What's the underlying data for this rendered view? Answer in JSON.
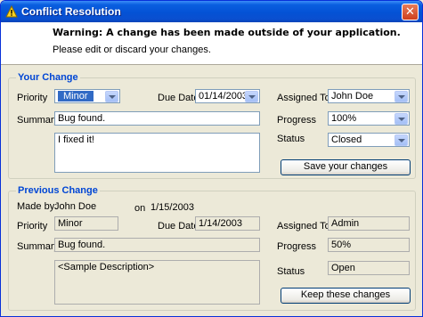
{
  "window": {
    "title": "Conflict Resolution"
  },
  "header": {
    "warning_prefix": "Warning: A change ",
    "warning_bold1": "has been made",
    "warning_mid": " ",
    "warning_bold2": "outside",
    "warning_suffix": " of your application.",
    "subtext": "Please edit or discard your changes."
  },
  "your_change": {
    "title": "Your Change",
    "priority_label": "Priority",
    "priority_value": "Minor",
    "due_date_label": "Due Date",
    "due_date_value": "01/14/2003",
    "assigned_to_label": "Assigned To",
    "assigned_to_value": "John Doe",
    "summary_label": "Summary",
    "summary_value": "Bug found.",
    "progress_label": "Progress",
    "progress_value": "100%",
    "description_value": "I fixed it!",
    "status_label": "Status",
    "status_value": "Closed",
    "save_button": "Save your changes"
  },
  "previous_change": {
    "title": "Previous Change",
    "made_by_label": "Made by:",
    "made_by_value": "John Doe",
    "on_label": "on",
    "on_value": "1/15/2003",
    "priority_label": "Priority",
    "priority_value": "Minor",
    "due_date_label": "Due Date",
    "due_date_value": "1/14/2003",
    "assigned_to_label": "Assigned To",
    "assigned_to_value": "Admin",
    "summary_label": "Summary",
    "summary_value": "Bug found.",
    "progress_label": "Progress",
    "progress_value": "50%",
    "description_value": "<Sample Description>",
    "status_label": "Status",
    "status_value": "Open",
    "keep_button": "Keep these changes"
  }
}
